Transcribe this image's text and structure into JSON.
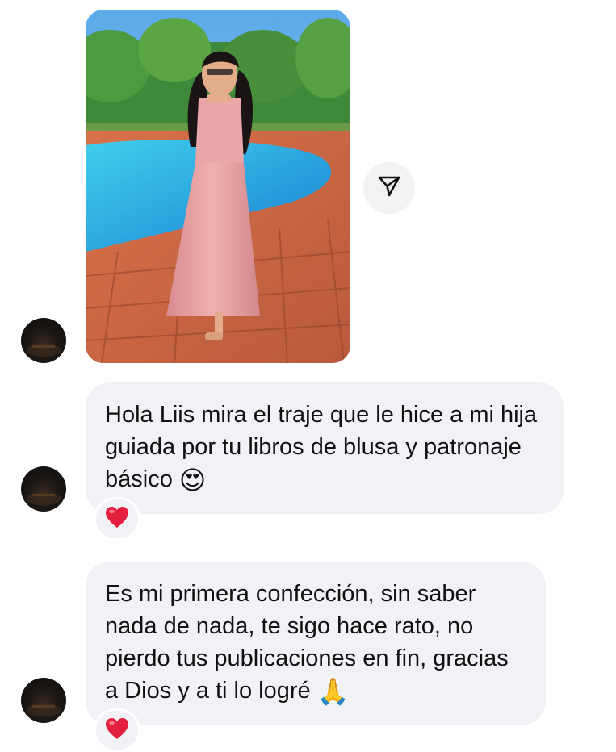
{
  "conversation": {
    "photo": {
      "icon": "shared-photo"
    },
    "share": {
      "icon": "send-icon"
    },
    "messages": [
      {
        "text": "Hola Liis mira el traje que le hice a mi hija guiada por tu libros de blusa y patronaje básico",
        "emoji": "😍",
        "reaction": "❤️"
      },
      {
        "text": "Es mi primera confección, sin saber nada de nada, te sigo hace rato, no pierdo tus publicaciones en fin, gracias a Dios y a ti lo logré",
        "emoji": "🙏",
        "reaction": "❤️"
      }
    ]
  },
  "colors": {
    "bubble": "#f0f2f5",
    "heart": "#e41e3f",
    "text": "#111111"
  }
}
